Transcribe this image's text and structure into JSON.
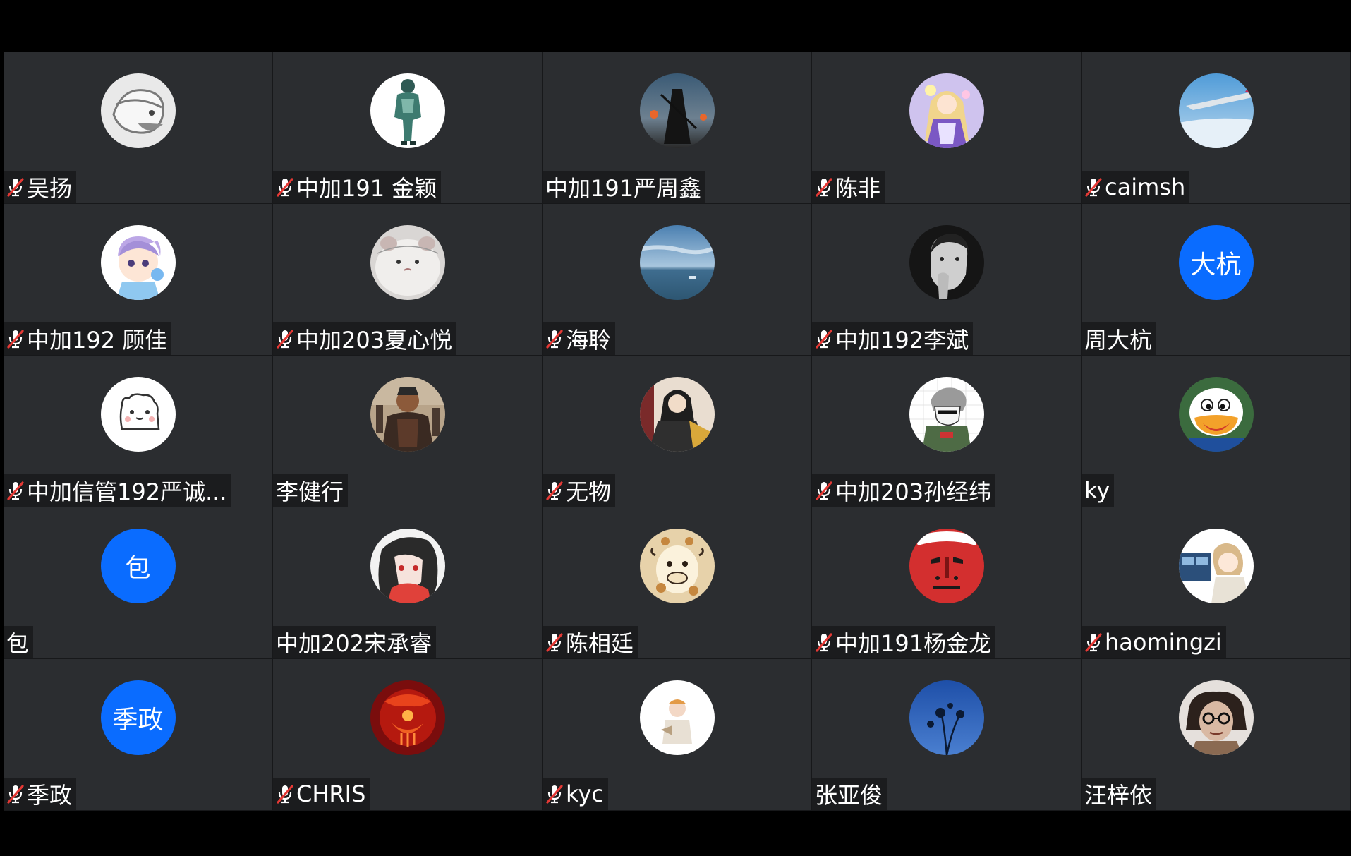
{
  "participants": [
    {
      "name": "吴扬",
      "muted": true,
      "avatar": "avatar-grey-bird"
    },
    {
      "name": "中加191 金颖",
      "muted": true,
      "avatar": "avatar-robot-figure"
    },
    {
      "name": "中加191严周鑫",
      "muted": false,
      "avatar": "avatar-dark-warrior"
    },
    {
      "name": "陈非",
      "muted": true,
      "avatar": "avatar-anime-purple"
    },
    {
      "name": "caimsh",
      "muted": true,
      "avatar": "avatar-airplane-sky"
    },
    {
      "name": "中加192 顾佳",
      "muted": true,
      "avatar": "avatar-cartoon-boy"
    },
    {
      "name": "中加203夏心悦",
      "muted": true,
      "avatar": "avatar-hamster"
    },
    {
      "name": "海聆",
      "muted": true,
      "avatar": "avatar-sea"
    },
    {
      "name": "中加192李斌",
      "muted": true,
      "avatar": "avatar-bw-man"
    },
    {
      "name": "周大杭",
      "muted": false,
      "avatar": "text",
      "avatar_text": "大杭"
    },
    {
      "name": "中加信管192严诚...",
      "muted": true,
      "avatar": "avatar-white-bear"
    },
    {
      "name": "李健行",
      "muted": false,
      "avatar": "avatar-armored-general"
    },
    {
      "name": "无物",
      "muted": true,
      "avatar": "avatar-ancient-costume"
    },
    {
      "name": "中加203孙经纬",
      "muted": true,
      "avatar": "avatar-sketch-boy"
    },
    {
      "name": "ky",
      "muted": false,
      "avatar": "avatar-donald-duck"
    },
    {
      "name": "包",
      "muted": false,
      "avatar": "text",
      "avatar_text": "包"
    },
    {
      "name": "中加202宋承睿",
      "muted": false,
      "avatar": "avatar-red-anime-girl"
    },
    {
      "name": "陈相廷",
      "muted": true,
      "avatar": "avatar-giraffe"
    },
    {
      "name": "中加191杨金龙",
      "muted": true,
      "avatar": "avatar-red-mask"
    },
    {
      "name": "haomingzi",
      "muted": true,
      "avatar": "avatar-anime-window"
    },
    {
      "name": "季政",
      "muted": true,
      "avatar": "text",
      "avatar_text": "季政"
    },
    {
      "name": "CHRIS",
      "muted": true,
      "avatar": "avatar-red-dragon"
    },
    {
      "name": "kyc",
      "muted": true,
      "avatar": "avatar-white-person"
    },
    {
      "name": "张亚俊",
      "muted": false,
      "avatar": "avatar-blue-flowers"
    },
    {
      "name": "汪梓依",
      "muted": false,
      "avatar": "avatar-glasses-girl"
    }
  ],
  "colors": {
    "tile_bg": "#2b2d30",
    "namebar_bg": "#1b1c1e",
    "text_avatar_bg": "#0a6cff",
    "mute_icon": "#e53935"
  }
}
